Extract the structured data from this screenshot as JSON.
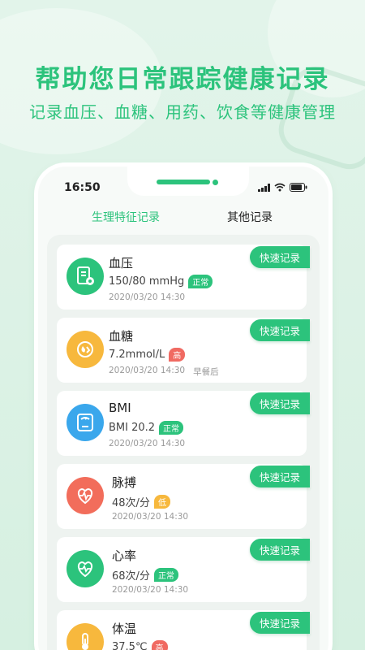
{
  "headline": "帮助您日常跟踪健康记录",
  "subline": "记录血压、血糖、用药、饮食等健康管理",
  "status": {
    "time": "16:50"
  },
  "tabs": [
    {
      "label": "生理特征记录",
      "active": true
    },
    {
      "label": "其他记录",
      "active": false
    }
  ],
  "records": [
    {
      "title": "血压",
      "value": "150/80 mmHg",
      "badge": "正常",
      "badge_color": "#2cc37c",
      "date": "2020/03/20 14:30",
      "note": "",
      "icon": "blood-pressure-icon",
      "icon_color": "#2cc37c",
      "action": "快速记录"
    },
    {
      "title": "血糖",
      "value": "7.2mmol/L",
      "badge": "高",
      "badge_color": "#f06a62",
      "date": "2020/03/20 14:30",
      "note": "早餐后",
      "icon": "blood-sugar-icon",
      "icon_color": "#f7b83d",
      "action": "快速记录"
    },
    {
      "title": "BMI",
      "value": "BMI 20.2",
      "badge": "正常",
      "badge_color": "#2cc37c",
      "date": "2020/03/20 14:30",
      "note": "",
      "icon": "scale-icon",
      "icon_color": "#3aa7ec",
      "action": "快速记录"
    },
    {
      "title": "脉搏",
      "value": "48次/分",
      "badge": "低",
      "badge_color": "#f7b83d",
      "date": "2020/03/20 14:30",
      "note": "",
      "icon": "pulse-icon",
      "icon_color": "#f26d5b",
      "action": "快速记录"
    },
    {
      "title": "心率",
      "value": "68次/分",
      "badge": "正常",
      "badge_color": "#2cc37c",
      "date": "2020/03/20 14:30",
      "note": "",
      "icon": "heart-rate-icon",
      "icon_color": "#2cc37c",
      "action": "快速记录"
    },
    {
      "title": "体温",
      "value": "37.5℃",
      "badge": "高",
      "badge_color": "#f06a62",
      "date": "",
      "note": "",
      "icon": "thermometer-icon",
      "icon_color": "#f7b83d",
      "action": "快速记录"
    }
  ]
}
